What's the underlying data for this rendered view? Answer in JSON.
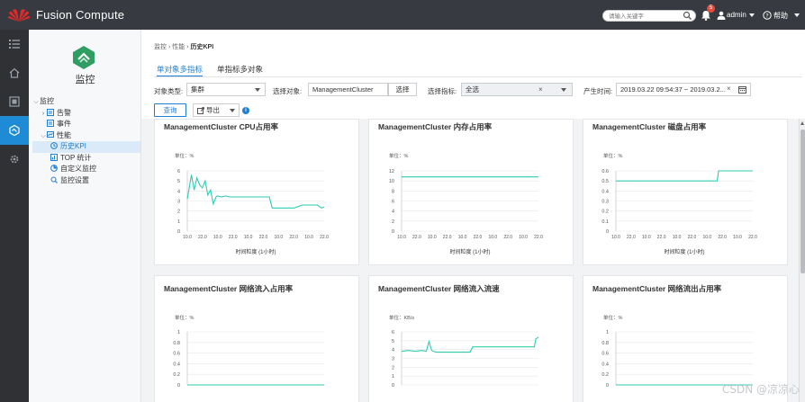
{
  "topbar": {
    "brand": "Fusion Compute",
    "search_placeholder": "请输入关键字",
    "alarm_count": "5",
    "username": "admin",
    "help_label": "帮助"
  },
  "nav": {
    "title": "监控",
    "tree": [
      {
        "label": "监控",
        "level": 0,
        "arrow": "expanded",
        "icon": ""
      },
      {
        "label": "告警",
        "level": 1,
        "arrow": "collapsed",
        "icon": "alarm-icon"
      },
      {
        "label": "事件",
        "level": 1,
        "arrow": "",
        "icon": "event-icon"
      },
      {
        "label": "性能",
        "level": 1,
        "arrow": "expanded",
        "icon": "performance-icon"
      },
      {
        "label": "历史KPI",
        "level": 2,
        "arrow": "",
        "icon": "history-kpi-icon",
        "selected": true
      },
      {
        "label": "TOP 统计",
        "level": 2,
        "arrow": "",
        "icon": "top-stats-icon"
      },
      {
        "label": "自定义监控",
        "level": 2,
        "arrow": "",
        "icon": "custom-monitor-icon"
      },
      {
        "label": "监控设置",
        "level": 2,
        "arrow": "",
        "icon": "monitor-settings-icon"
      }
    ]
  },
  "main": {
    "breadcrumb": [
      "监控",
      "性能",
      "历史KPI"
    ],
    "tabs": [
      "单对象多指标",
      "单指标多对象"
    ],
    "filters": {
      "object_type_label": "对象类型:",
      "object_type_value": "集群",
      "select_object_label": "选择对象:",
      "select_object_value": "ManagementCluster",
      "select_button": "选择",
      "select_metric_label": "选择指标:",
      "select_metric_value": "全选",
      "time_label": "产生时间:",
      "time_value": "2019.03.22 09:54:37 ~ 2019.03.2..."
    },
    "query_button": "查询",
    "export_button": "导出"
  },
  "colors": {
    "line": "#2ecbb2",
    "accent": "#1f7fd1",
    "topbar": "#373a40"
  },
  "watermark": "CSDN @凉凉心",
  "chart_data": [
    {
      "type": "line",
      "title": "ManagementCluster CPU占用率",
      "unit": "单位：%",
      "xlabel": "时间粒度 (1小时)",
      "yticks": [
        "6",
        "5",
        "4",
        "3",
        "2",
        "1",
        "0"
      ],
      "ylim": [
        0,
        6
      ],
      "xticks": [
        "10.0",
        "22.0",
        "10.0",
        "22.0",
        "10.0",
        "22.0",
        "10.0",
        "22.0",
        "10.0",
        "22.0"
      ],
      "x": [
        0,
        0.03,
        0.05,
        0.07,
        0.09,
        0.11,
        0.13,
        0.15,
        0.17,
        0.19,
        0.21,
        0.22,
        0.25,
        0.28,
        0.31,
        0.34,
        0.37,
        0.4,
        0.44,
        0.48,
        0.52,
        0.56,
        0.6,
        0.62,
        0.66,
        0.72,
        0.78,
        0.84,
        0.9,
        0.95,
        0.98,
        1.0
      ],
      "y": [
        3.2,
        5.6,
        4.1,
        5.3,
        4.6,
        4.3,
        5.0,
        3.6,
        4.1,
        2.7,
        3.4,
        3.5,
        3.4,
        3.5,
        3.4,
        3.4,
        3.4,
        3.4,
        3.4,
        3.4,
        3.4,
        3.4,
        3.4,
        2.3,
        2.3,
        2.3,
        2.3,
        2.6,
        2.6,
        2.6,
        2.3,
        2.4
      ]
    },
    {
      "type": "line",
      "title": "ManagementCluster 内存占用率",
      "unit": "单位：%",
      "xlabel": "时间粒度 (1小时)",
      "yticks": [
        "12",
        "10",
        "8",
        "6",
        "4",
        "2",
        "0"
      ],
      "ylim": [
        0,
        12
      ],
      "xticks": [
        "10.0",
        "22.0",
        "10.0",
        "22.0",
        "10.0",
        "22.0",
        "10.0",
        "22.0",
        "10.0",
        "22.0"
      ],
      "x": [
        0,
        0.25,
        0.5,
        0.75,
        1.0
      ],
      "y": [
        10.8,
        10.8,
        10.8,
        10.8,
        10.8
      ]
    },
    {
      "type": "line",
      "title": "ManagementCluster 磁盘占用率",
      "unit": "单位：%",
      "xlabel": "时间粒度 (1小时)",
      "yticks": [
        "0.6",
        "0.5",
        "0.4",
        "0.3",
        "0.2",
        "0.1",
        "0"
      ],
      "ylim": [
        0,
        0.6
      ],
      "xticks": [
        "10.0",
        "22.0",
        "10.0",
        "22.0",
        "10.0",
        "22.0",
        "10.0",
        "22.0",
        "10.0",
        "22.0"
      ],
      "x": [
        0,
        0.3,
        0.6,
        0.74,
        0.75,
        0.9,
        1.0
      ],
      "y": [
        0.5,
        0.5,
        0.5,
        0.5,
        0.6,
        0.6,
        0.6
      ]
    },
    {
      "type": "line",
      "title": "ManagementCluster 网络流入占用率",
      "unit": "单位：%",
      "xlabel": "",
      "yticks": [
        "1",
        "0.8",
        "0.6",
        "0.4",
        "0.2",
        "0"
      ],
      "ylim": [
        0,
        1
      ],
      "xticks": [],
      "x": [
        0,
        1.0
      ],
      "y": [
        0,
        0
      ]
    },
    {
      "type": "line",
      "title": "ManagementCluster 网络流入流速",
      "unit": "单位：KB/s",
      "xlabel": "",
      "yticks": [
        "6",
        "5",
        "4",
        "3",
        "2",
        "1",
        "0"
      ],
      "ylim": [
        0,
        6
      ],
      "xticks": [],
      "x": [
        0,
        0.05,
        0.1,
        0.15,
        0.18,
        0.2,
        0.22,
        0.25,
        0.4,
        0.5,
        0.52,
        0.7,
        0.85,
        0.9,
        0.97,
        0.98,
        1.0
      ],
      "y": [
        3.8,
        3.9,
        3.8,
        3.9,
        3.8,
        4.9,
        3.9,
        3.7,
        3.7,
        3.7,
        4.3,
        4.3,
        4.3,
        4.3,
        4.3,
        5.2,
        5.4
      ]
    },
    {
      "type": "line",
      "title": "ManagementCluster 网络流出占用率",
      "unit": "单位：%",
      "xlabel": "",
      "yticks": [
        "1",
        "0.8",
        "0.6",
        "0.4",
        "0.2",
        "0"
      ],
      "ylim": [
        0,
        1
      ],
      "xticks": [],
      "x": [
        0,
        1.0
      ],
      "y": [
        0,
        0
      ]
    }
  ]
}
